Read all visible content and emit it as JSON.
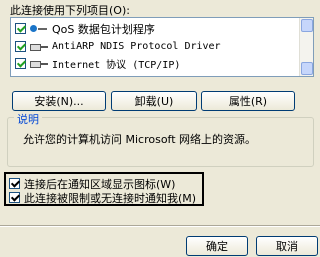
{
  "components_label": "此连接使用下列项目(O):",
  "components": [
    {
      "label": "QoS 数据包计划程序",
      "checked": true,
      "icon": "qos-icon"
    },
    {
      "label": "AntiARP NDIS Protocol Driver",
      "checked": true,
      "icon": "protocol-icon"
    },
    {
      "label": "Internet 协议 (TCP/IP)",
      "checked": true,
      "icon": "protocol-icon"
    }
  ],
  "buttons": {
    "install": "安装(N)...",
    "uninstall": "卸载(U)",
    "properties": "属性(R)"
  },
  "description": {
    "legend": "说明",
    "text": "允许您的计算机访问 Microsoft 网络上的资源。"
  },
  "options": [
    {
      "label": "连接后在通知区域显示图标(W)",
      "checked": true
    },
    {
      "label": "此连接被限制或无连接时通知我(M)",
      "checked": true
    }
  ],
  "dialog": {
    "ok": "确定",
    "cancel": "取消"
  }
}
